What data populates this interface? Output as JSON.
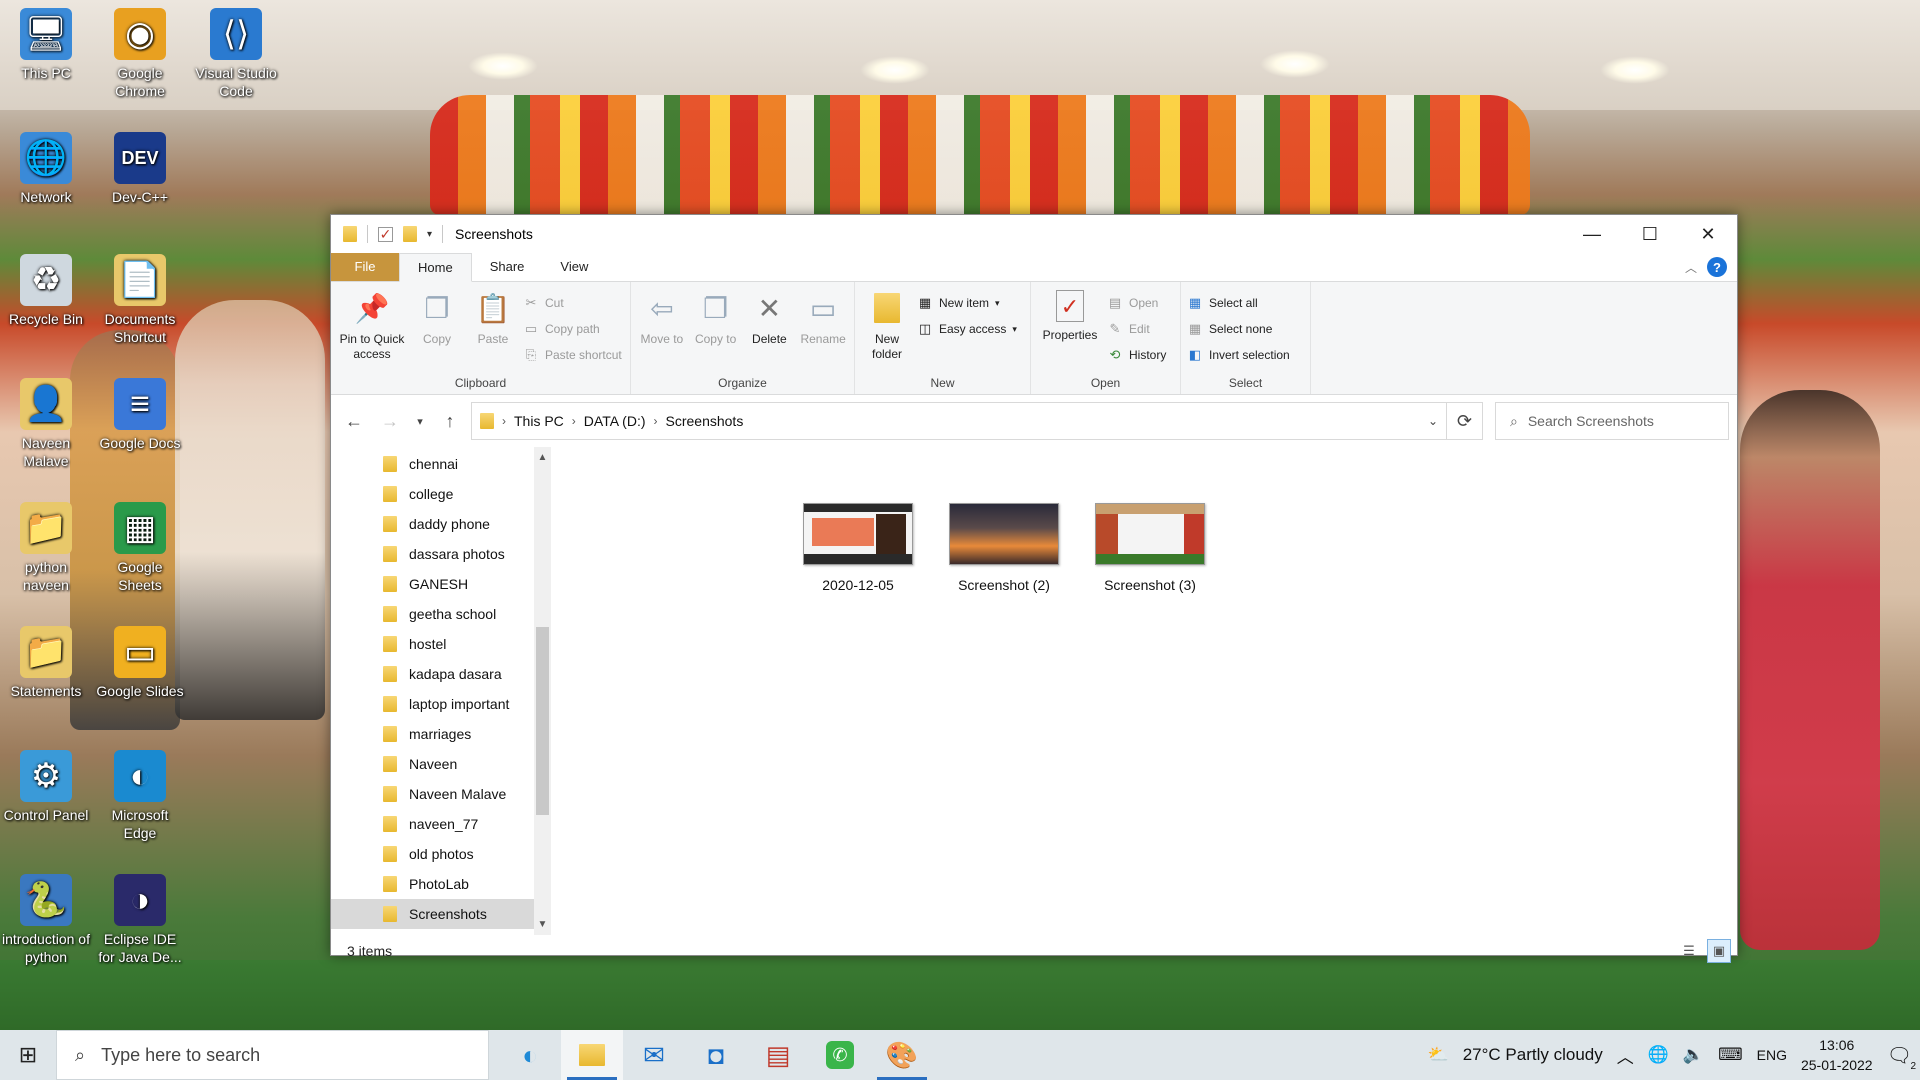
{
  "desktop": {
    "icons": [
      {
        "label": "This PC",
        "glyph": "🖥"
      },
      {
        "label": "Google Chrome",
        "glyph": "◉"
      },
      {
        "label": "Visual Studio Code",
        "glyph": "⟨⟩"
      },
      {
        "label": "Network",
        "glyph": "🌐"
      },
      {
        "label": "Dev-C++",
        "glyph": "DEV"
      },
      {
        "label": "Recycle Bin",
        "glyph": "♻"
      },
      {
        "label": "Documents Shortcut",
        "glyph": "📄"
      },
      {
        "label": "Naveen Malave",
        "glyph": "👤"
      },
      {
        "label": "Google Docs",
        "glyph": "≡"
      },
      {
        "label": "python naveen",
        "glyph": "📁"
      },
      {
        "label": "Google Sheets",
        "glyph": "▦"
      },
      {
        "label": "Statements",
        "glyph": "📁"
      },
      {
        "label": "Google Slides",
        "glyph": "▭"
      },
      {
        "label": "Control Panel",
        "glyph": "⚙"
      },
      {
        "label": "Microsoft Edge",
        "glyph": "◐"
      },
      {
        "label": "introduction of python",
        "glyph": "🐍"
      },
      {
        "label": "Eclipse IDE for Java De...",
        "glyph": "◑"
      }
    ]
  },
  "window": {
    "title": "Screenshots",
    "controls": {
      "minimize": "—",
      "maximize": "☐",
      "close": "✕"
    }
  },
  "ribbon_tabs": [
    "File",
    "Home",
    "Share",
    "View"
  ],
  "ribbon": {
    "clipboard": {
      "name": "Clipboard",
      "pin": "Pin to Quick access",
      "copy": "Copy",
      "paste": "Paste",
      "cut": "Cut",
      "copy_path": "Copy path",
      "paste_shortcut": "Paste shortcut"
    },
    "organize": {
      "name": "Organize",
      "move_to": "Move to",
      "copy_to": "Copy to",
      "delete": "Delete",
      "rename": "Rename"
    },
    "new": {
      "name": "New",
      "new_folder": "New folder",
      "new_item": "New item",
      "easy_access": "Easy access"
    },
    "open": {
      "name": "Open",
      "properties": "Properties",
      "open": "Open",
      "edit": "Edit",
      "history": "History"
    },
    "select": {
      "name": "Select",
      "select_all": "Select all",
      "select_none": "Select none",
      "invert": "Invert selection"
    }
  },
  "address": {
    "crumbs": [
      "This PC",
      "DATA (D:)",
      "Screenshots"
    ],
    "search_placeholder": "Search Screenshots"
  },
  "nav_folders": [
    "chennai",
    "college",
    "daddy phone",
    "dassara photos",
    "GANESH",
    "geetha school",
    "hostel",
    "kadapa dasara",
    "laptop important",
    "marriages",
    "Naveen",
    "Naveen Malave",
    "naveen_77",
    "old photos",
    "PhotoLab",
    "Screenshots"
  ],
  "selected_folder": "Screenshots",
  "files": [
    {
      "name": "2020-12-05"
    },
    {
      "name": "Screenshot (2)"
    },
    {
      "name": "Screenshot (3)"
    }
  ],
  "status": {
    "item_count": "3 items"
  },
  "taskbar": {
    "search_placeholder": "Type here to search",
    "weather": "27°C  Partly cloudy",
    "language": "ENG",
    "time": "13:06",
    "date": "25-01-2022",
    "notifications": "2"
  }
}
